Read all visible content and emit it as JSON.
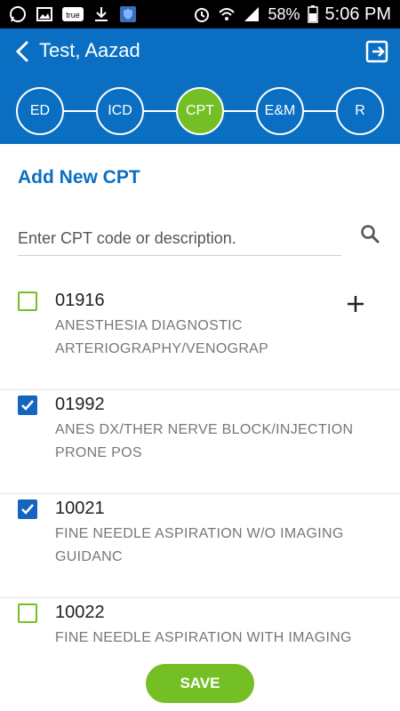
{
  "status_bar": {
    "battery": "58%",
    "time": "5:06 PM",
    "notification_icons": [
      "whatsapp-icon",
      "gallery-icon",
      "truecaller-icon",
      "download-icon",
      "shield-app-icon"
    ],
    "system_icons": [
      "alarm-icon",
      "wifi-icon",
      "signal-icon",
      "battery-icon"
    ]
  },
  "header": {
    "title": "Test, Aazad",
    "back_icon": "chevron-left-icon",
    "exit_icon": "exit-icon"
  },
  "stepper": {
    "steps": [
      {
        "label": "ED",
        "active": false
      },
      {
        "label": "ICD",
        "active": false
      },
      {
        "label": "CPT",
        "active": true
      },
      {
        "label": "E&M",
        "active": false
      },
      {
        "label": "R",
        "active": false
      }
    ]
  },
  "main": {
    "heading": "Add New CPT",
    "search": {
      "placeholder": "Enter CPT code or description.",
      "value": ""
    },
    "items": [
      {
        "code": "01916",
        "description": "ANESTHESIA DIAGNOSTIC ARTERIOGRAPHY/VENOGRAP",
        "checked": false,
        "has_add": true
      },
      {
        "code": "01992",
        "description": "ANES DX/THER NERVE BLOCK/INJECTION PRONE POS",
        "checked": true,
        "has_add": false
      },
      {
        "code": "10021",
        "description": "FINE NEEDLE ASPIRATION W/O IMAGING GUIDANC",
        "checked": true,
        "has_add": false
      },
      {
        "code": "10022",
        "description": "FINE NEEDLE ASPIRATION WITH IMAGING",
        "checked": false,
        "has_add": false
      }
    ]
  },
  "footer": {
    "save_label": "SAVE"
  },
  "colors": {
    "primary": "#0a6fc2",
    "accent": "#75bf26",
    "checkbox": "#1565c0"
  }
}
